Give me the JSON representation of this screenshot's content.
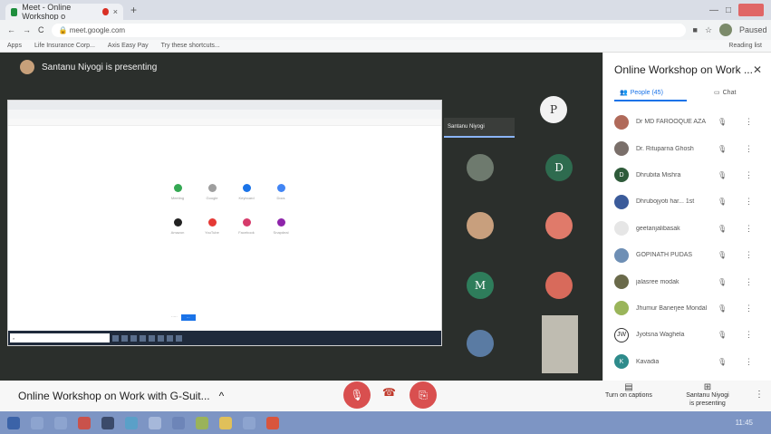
{
  "browser": {
    "tab_title": "Meet - Online Workshop o",
    "address": "meet.google.com",
    "bookmarks": [
      "Apps",
      "Life Insurance Corp...",
      "Axis Easy Pay",
      "Try these shortcuts..."
    ],
    "reading_list": "Reading list",
    "profile_label": "Paused"
  },
  "stage": {
    "presenter_text": "Santanu Niyogi is presenting",
    "pill_name": "Santanu Niyogi"
  },
  "tiles": [
    {
      "label": "P",
      "color": "#f2f2f2",
      "fg": "#333"
    },
    {
      "label": "",
      "color": "#6e7a6e",
      "fg": "#fff"
    },
    {
      "label": "D",
      "color": "#2e6b4f",
      "fg": "#fff"
    },
    {
      "label": "",
      "color": "#c89f7d",
      "fg": "#fff"
    },
    {
      "label": "",
      "color": "#e07a6a",
      "fg": "#fff"
    },
    {
      "label": "M",
      "color": "#2e7d5b",
      "fg": "#fff"
    },
    {
      "label": "",
      "color": "#d86a5b",
      "fg": "#fff"
    },
    {
      "label": "",
      "color": "#5a7ba3",
      "fg": "#fff"
    }
  ],
  "shared_apps": [
    "Meeting",
    "Google",
    "Keyboard",
    "Docs",
    "Amazon",
    "YouTube",
    "Facebook",
    "Snapdeal"
  ],
  "meetbar": {
    "title": "Online Workshop on Work with G-Suit...",
    "turn_on_captions": "Turn on captions",
    "presenting_label": "Santanu Niyogi is presenting"
  },
  "panel": {
    "title": "Online Workshop on Work ...",
    "people_tab": "People (45)",
    "chat_tab": "Chat",
    "participants": [
      {
        "name": "Dr MD FAROOQUE AZA",
        "color": "#b06a5a",
        "initial": ""
      },
      {
        "name": "Dr. Rituparna Ghosh",
        "color": "#7a6f6a",
        "initial": ""
      },
      {
        "name": "Dhrubita Mishra",
        "color": "#2e5b3a",
        "initial": "D"
      },
      {
        "name": "Dhrubojyoti har... 1st",
        "color": "#3b5b9a",
        "initial": ""
      },
      {
        "name": "geetanjalibasak",
        "color": "#e6e6e6",
        "initial": ""
      },
      {
        "name": "GOPINATH PUDAS",
        "color": "#6e8fb5",
        "initial": ""
      },
      {
        "name": "jalasree modak",
        "color": "#6a6a4a",
        "initial": ""
      },
      {
        "name": "Jhumur Banerjee Mondal",
        "color": "#9ab55a",
        "initial": ""
      },
      {
        "name": "Jyotsna Waghela",
        "color": "#ffffff",
        "initial": "JW"
      },
      {
        "name": "Kavadia",
        "color": "#2e8b8b",
        "initial": "K"
      }
    ]
  },
  "taskbar": {
    "clock": "11:45"
  },
  "colors": {
    "stage_bg": "#2b2f2c",
    "accent": "#1a73e8",
    "mic_off": "#d94f4f"
  }
}
